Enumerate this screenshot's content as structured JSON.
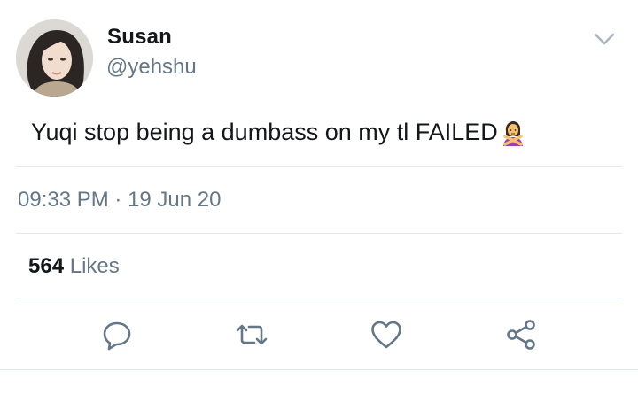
{
  "author": {
    "name": "Susan",
    "handle": "@yehshu"
  },
  "tweet": {
    "text": "Yuqi stop being a dumbass on my tl FAILED",
    "emoji": "woman-gesturing-no-emoji"
  },
  "meta": {
    "time": "09:33 PM",
    "separator": " · ",
    "date": "19 Jun 20"
  },
  "stats": {
    "likes_count": "564",
    "likes_label": " Likes"
  },
  "actions": {
    "reply": "reply-icon",
    "retweet": "retweet-icon",
    "like": "heart-icon",
    "share": "share-icon"
  },
  "colors": {
    "icon": "#657786",
    "text": "#14171a",
    "secondary": "#657786",
    "divider": "#e1e8ed"
  }
}
